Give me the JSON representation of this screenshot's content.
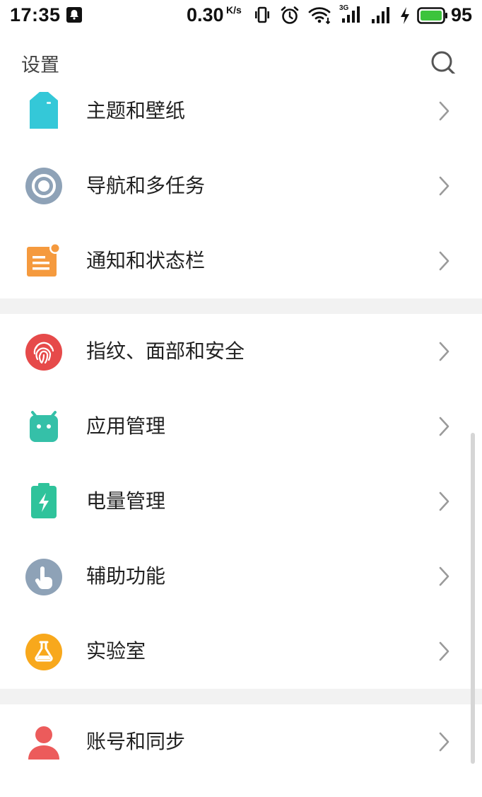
{
  "status_bar": {
    "time": "17:35",
    "net_speed": "0.30",
    "net_speed_unit": "K/s",
    "network_label": "3G",
    "battery_percent": "95",
    "battery_color": "#3cc43c"
  },
  "header": {
    "title": "设置"
  },
  "groups": [
    {
      "items": [
        {
          "label": "主题和壁纸",
          "icon": "theme-shirt-icon",
          "color": "#34c8d8"
        },
        {
          "label": "导航和多任务",
          "icon": "navigation-circle-icon",
          "color": "#8ea2b7"
        },
        {
          "label": "通知和状态栏",
          "icon": "notification-icon",
          "color": "#f59a3e"
        }
      ]
    },
    {
      "items": [
        {
          "label": "指纹、面部和安全",
          "icon": "fingerprint-icon",
          "color": "#e64a4a"
        },
        {
          "label": "应用管理",
          "icon": "android-icon",
          "color": "#35c0a8"
        },
        {
          "label": "电量管理",
          "icon": "battery-bolt-icon",
          "color": "#2fc39b"
        },
        {
          "label": "辅助功能",
          "icon": "touch-hand-icon",
          "color": "#8ea2b7"
        },
        {
          "label": "实验室",
          "icon": "flask-icon",
          "color": "#f8a81c"
        }
      ]
    },
    {
      "items": [
        {
          "label": "账号和同步",
          "icon": "account-person-icon",
          "color": "#ec5b5b"
        }
      ]
    }
  ]
}
